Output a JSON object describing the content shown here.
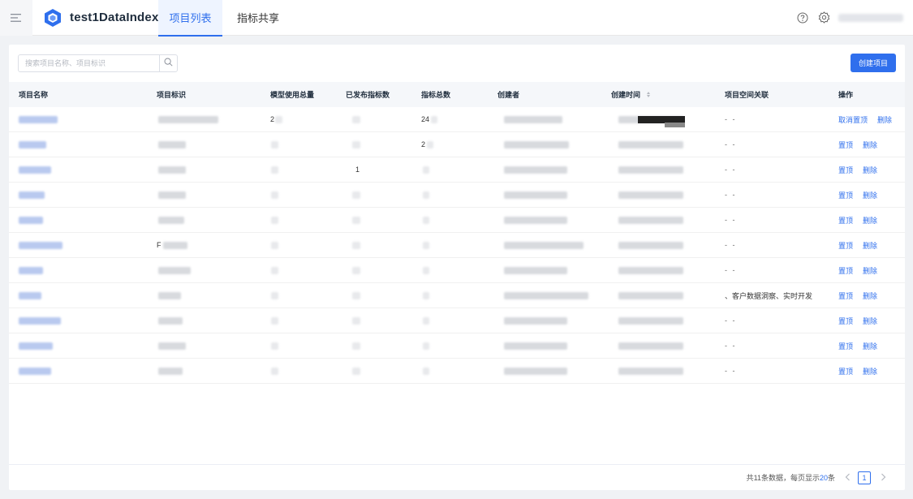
{
  "header": {
    "app_title": "test1DataIndex",
    "tabs": [
      {
        "label": "项目列表",
        "active": true
      },
      {
        "label": "指标共享",
        "active": false
      }
    ],
    "icons": {
      "menu": "menu-fold-icon",
      "logo": "cube-logo-icon",
      "help": "help-circle-icon",
      "settings": "gear-icon"
    }
  },
  "toolbar": {
    "search_placeholder": "搜索项目名称、项目标识",
    "create_label": "创建项目"
  },
  "table": {
    "columns": [
      "项目名称",
      "项目标识",
      "模型使用总量",
      "已发布指标数",
      "指标总数",
      "创建者",
      "创建时间",
      "项目空间关联",
      "操作"
    ],
    "rows": [
      {
        "model_usage": "2",
        "published": "",
        "total": "24",
        "space": "- -",
        "actions": [
          "取消置顶",
          "删除"
        ]
      },
      {
        "model_usage": "",
        "published": "",
        "total": "2",
        "space": "- -",
        "actions": [
          "置顶",
          "删除"
        ]
      },
      {
        "model_usage": "",
        "published": "1",
        "total": "",
        "space": "- -",
        "actions": [
          "置顶",
          "删除"
        ]
      },
      {
        "model_usage": "",
        "published": "",
        "total": "",
        "space": "- -",
        "actions": [
          "置顶",
          "删除"
        ]
      },
      {
        "model_usage": "",
        "published": "",
        "total": "",
        "space": "- -",
        "actions": [
          "置顶",
          "删除"
        ]
      },
      {
        "identifier": "F",
        "model_usage": "",
        "published": "",
        "total": "",
        "space": "- -",
        "actions": [
          "置顶",
          "删除"
        ]
      },
      {
        "model_usage": "",
        "published": "",
        "total": "",
        "space": "- -",
        "actions": [
          "置顶",
          "删除"
        ]
      },
      {
        "model_usage": "",
        "published": "",
        "total": "",
        "space": "、客户数据洞察、实时开发",
        "actions": [
          "置顶",
          "删除"
        ]
      },
      {
        "model_usage": "",
        "published": "",
        "total": "",
        "space": "- -",
        "actions": [
          "置顶",
          "删除"
        ]
      },
      {
        "model_usage": "",
        "published": "",
        "total": "",
        "space": "- -",
        "actions": [
          "置顶",
          "删除"
        ]
      },
      {
        "model_usage": "",
        "published": "",
        "total": "",
        "space": "- -",
        "actions": [
          "置顶",
          "删除"
        ]
      }
    ]
  },
  "pagination": {
    "prefix": "共",
    "total": "11",
    "middle": "条数据，每页显示",
    "page_size": "20",
    "suffix": "条",
    "current_page": "1"
  },
  "colors": {
    "accent": "#2f6fed",
    "header_bg": "#ffffff",
    "page_bg": "#f0f2f5"
  }
}
